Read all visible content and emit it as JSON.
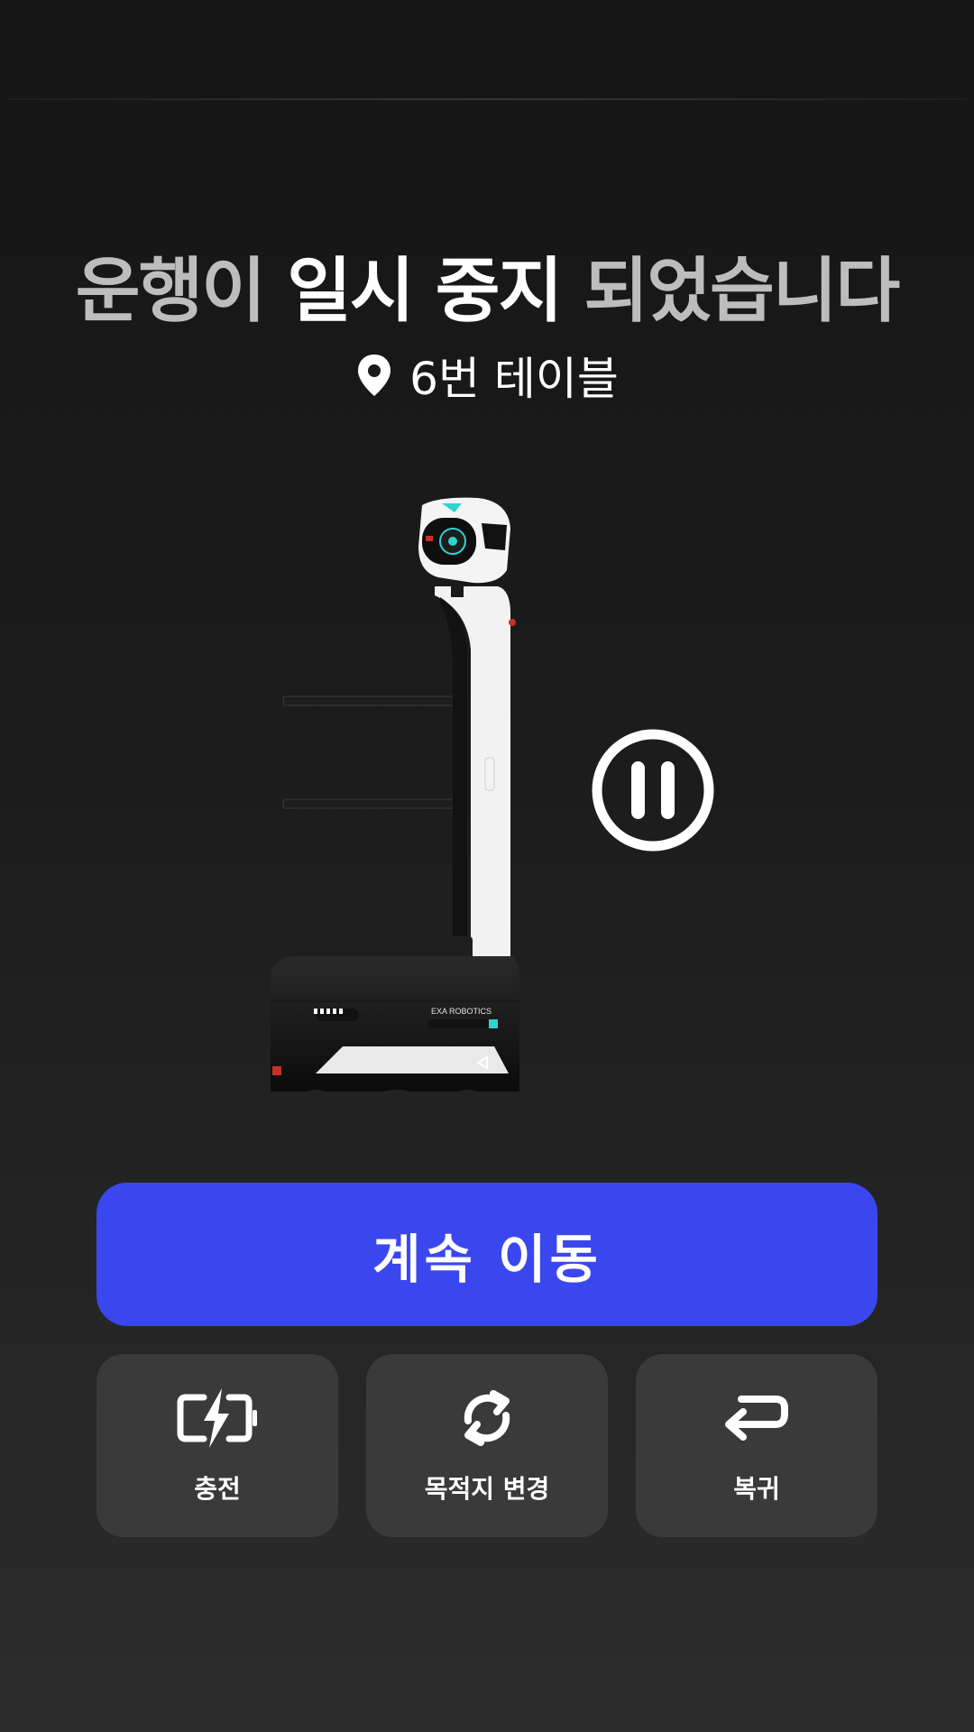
{
  "header": {
    "title_prefix": "운행이",
    "title_emphasis": "일시 중지",
    "title_suffix": "되었습니다",
    "location_icon": "location-pin-icon",
    "location": "6번 테이블"
  },
  "status": {
    "state_icon": "pause-circle-icon",
    "robot_brand_marking": "EXA ROBOTICS"
  },
  "primary_action": {
    "label": "계속 이동",
    "color": "#3b47ee"
  },
  "actions": [
    {
      "icon": "battery-charging-icon",
      "label": "충전"
    },
    {
      "icon": "refresh-icon",
      "label": "목적지 변경"
    },
    {
      "icon": "return-icon",
      "label": "복귀"
    }
  ]
}
